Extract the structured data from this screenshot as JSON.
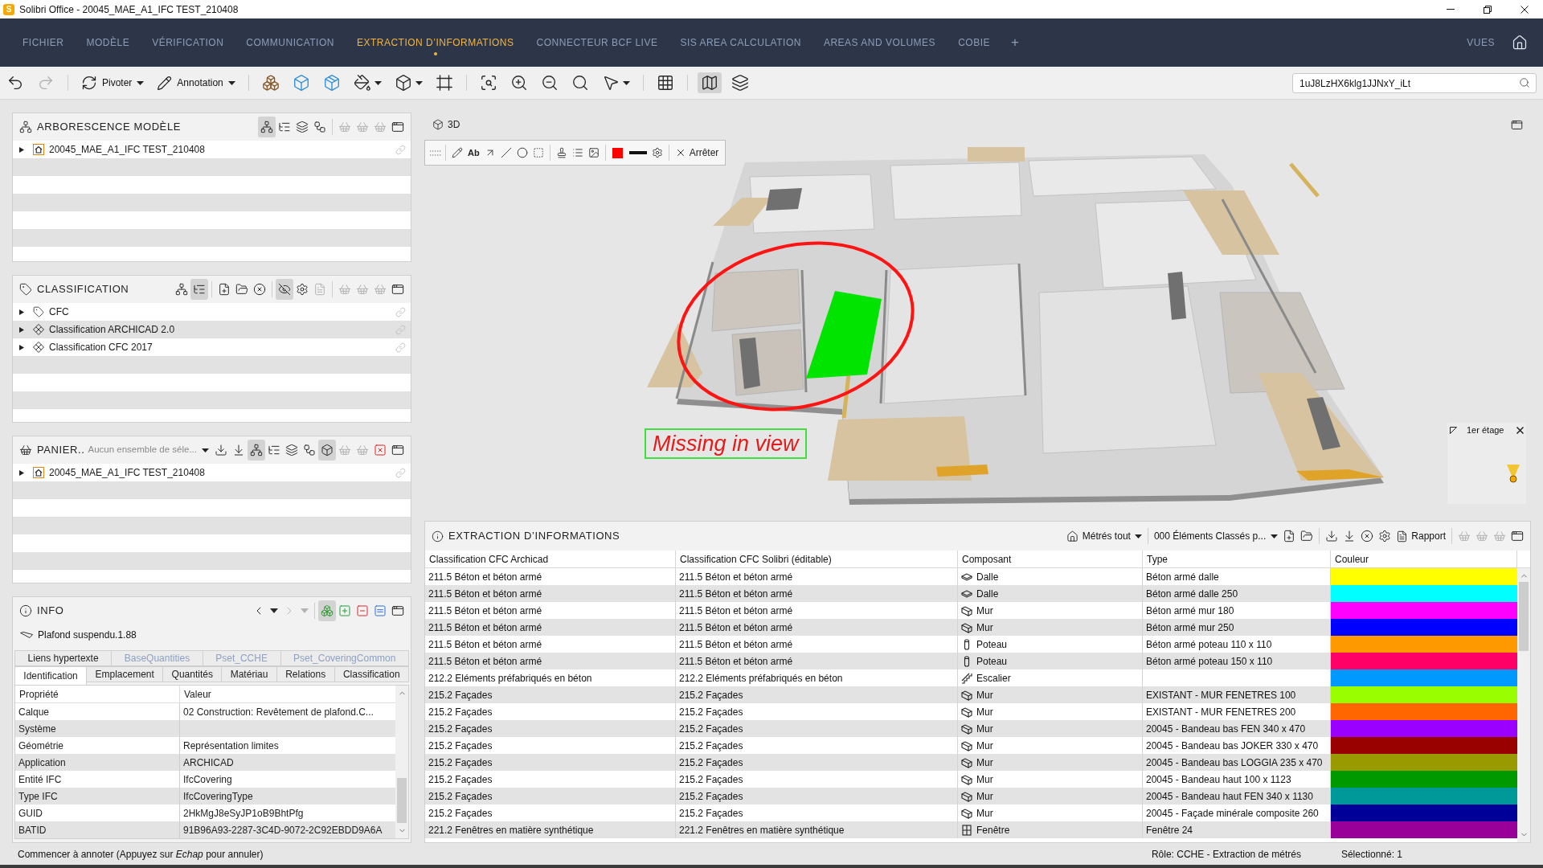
{
  "window": {
    "logo": "S",
    "title": "Solibri Office - 20045_MAE_A1_IFC TEST_210408"
  },
  "menu": {
    "items": [
      {
        "label": "FICHIER",
        "selected": false
      },
      {
        "label": "MODÈLE",
        "selected": false
      },
      {
        "label": "VÉRIFICATION",
        "selected": false
      },
      {
        "label": "COMMUNICATION",
        "selected": false
      },
      {
        "label": "EXTRACTION D’INFORMATIONS",
        "selected": true
      },
      {
        "label": "CONNECTEUR BCF LIVE",
        "selected": false
      },
      {
        "label": "SIS AREA CALCULATION",
        "selected": false
      },
      {
        "label": "AREAS AND VOLUMES",
        "selected": false
      },
      {
        "label": "COBIE",
        "selected": false
      }
    ],
    "add": "+",
    "views": "VUES"
  },
  "toolbar": {
    "rotate": "Pivoter",
    "annotation": "Annotation",
    "tools": [
      {
        "pressed": false,
        "disabled": false
      },
      {
        "pressed": false,
        "disabled": true
      },
      {
        "pressed": false,
        "disabled": false
      },
      {
        "pressed": false,
        "disabled": false
      },
      {
        "pressed": false,
        "disabled": false
      },
      {
        "pressed": false,
        "disabled": false
      },
      {
        "pressed": false,
        "disabled": false
      },
      {
        "pressed": false,
        "disabled": false
      },
      {
        "pressed": false,
        "disabled": false
      },
      {
        "pressed": false,
        "disabled": false
      },
      {
        "pressed": false,
        "disabled": false
      },
      {
        "pressed": false,
        "disabled": false
      },
      {
        "pressed": false,
        "disabled": false
      },
      {
        "pressed": false,
        "disabled": false
      },
      {
        "pressed": true,
        "disabled": false
      },
      {
        "pressed": false,
        "disabled": false
      }
    ],
    "search": {
      "value": "1uJ8LzHX6klg1JJNxY_iLt"
    }
  },
  "model_tree": {
    "title": "ARBORESCENCE MODÈLE",
    "tools": [
      {
        "pressed": true,
        "disabled": false
      },
      {
        "pressed": false,
        "disabled": false
      },
      {
        "pressed": false,
        "disabled": false
      },
      {
        "pressed": false,
        "disabled": false
      },
      {
        "pressed": false,
        "disabled": true
      },
      {
        "pressed": false,
        "disabled": true
      },
      {
        "pressed": false,
        "disabled": true
      },
      {
        "pressed": false,
        "disabled": false
      }
    ],
    "items": [
      {
        "kind": "model",
        "label": "20045_MAE_A1_IFC TEST_210408",
        "expanded": false
      }
    ]
  },
  "classification": {
    "title": "CLASSIFICATION",
    "tools": [
      {
        "pressed": false,
        "disabled": false
      },
      {
        "pressed": true,
        "disabled": false
      },
      {
        "pressed": false,
        "disabled": false
      },
      {
        "pressed": false,
        "disabled": false
      },
      {
        "pressed": false,
        "disabled": false
      },
      {
        "pressed": true,
        "disabled": false
      },
      {
        "pressed": false,
        "disabled": false
      },
      {
        "pressed": false,
        "disabled": true
      },
      {
        "pressed": false,
        "disabled": true
      },
      {
        "pressed": false,
        "disabled": true
      },
      {
        "pressed": false,
        "disabled": true
      },
      {
        "pressed": false,
        "disabled": false
      }
    ],
    "items": [
      {
        "kind": "tag",
        "label": "CFC",
        "expanded": false
      },
      {
        "kind": "scheme",
        "label": "Classification ARCHICAD 2.0",
        "expanded": false
      },
      {
        "kind": "scheme",
        "label": "Classification CFC 2017",
        "expanded": false
      }
    ]
  },
  "basket": {
    "title": "PANIER..",
    "selection_set": "Aucun ensemble de séle...",
    "tools": [
      {
        "pressed": false,
        "disabled": false
      },
      {
        "pressed": false,
        "disabled": false
      },
      {
        "pressed": true,
        "disabled": false
      },
      {
        "pressed": false,
        "disabled": false
      },
      {
        "pressed": false,
        "disabled": false
      },
      {
        "pressed": false,
        "disabled": false
      },
      {
        "pressed": true,
        "disabled": false
      },
      {
        "pressed": false,
        "disabled": true
      },
      {
        "pressed": false,
        "disabled": true
      },
      {
        "pressed": false,
        "disabled": false
      },
      {
        "pressed": false,
        "disabled": false
      }
    ],
    "items": [
      {
        "kind": "model",
        "label": "20045_MAE_A1_IFC TEST_210408",
        "expanded": false
      }
    ]
  },
  "info": {
    "title": "INFO",
    "tools": [
      {
        "pressed": false,
        "disabled": false
      },
      {
        "pressed": false,
        "disabled": false
      },
      {
        "pressed": false,
        "disabled": true
      },
      {
        "pressed": false,
        "disabled": true
      },
      {
        "pressed": true,
        "disabled": false
      },
      {
        "pressed": false,
        "disabled": false
      },
      {
        "pressed": false,
        "disabled": false
      },
      {
        "pressed": false,
        "disabled": false
      },
      {
        "pressed": false,
        "disabled": false
      }
    ],
    "element": "Plafond suspendu.1.88",
    "tab_rows": [
      [
        {
          "label": "Liens hypertexte",
          "selected": false,
          "disabled": false
        },
        {
          "label": "BaseQuantities",
          "selected": false,
          "disabled": true
        },
        {
          "label": "Pset_CCHE",
          "selected": false,
          "disabled": true
        },
        {
          "label": "Pset_CoveringCommon",
          "selected": false,
          "disabled": true
        }
      ],
      [
        {
          "label": "Identification",
          "selected": true,
          "disabled": false
        },
        {
          "label": "Emplacement",
          "selected": false,
          "disabled": false
        },
        {
          "label": "Quantités",
          "selected": false,
          "disabled": false
        },
        {
          "label": "Matériau",
          "selected": false,
          "disabled": false
        },
        {
          "label": "Relations",
          "selected": false,
          "disabled": false
        },
        {
          "label": "Classification",
          "selected": false,
          "disabled": false
        }
      ]
    ],
    "columns": [
      "Propriété",
      "Valeur"
    ],
    "rows": [
      {
        "property": "Calque",
        "value": "02 Construction: Revêtement de plafond.C..."
      },
      {
        "property": "Système"
      },
      {
        "property": "Géométrie",
        "value": "Représentation limites"
      },
      {
        "property": "Application",
        "value": "ARCHICAD"
      },
      {
        "property": "Entité IFC",
        "value": "IfcCovering"
      },
      {
        "property": "Type IFC",
        "value": "IfcCoveringType"
      },
      {
        "property": "GUID",
        "value": "2HkMgJ8eSyJP1oB9BhtPfg"
      },
      {
        "property": "BATID",
        "value": "91B96A93-2287-3C4D-9072-2C92EBDD9A6A"
      }
    ]
  },
  "viewport": {
    "title": "3D",
    "text_tool": "Ab",
    "stop": "Arrêter",
    "annotation_text": "Missing in view",
    "minimap": {
      "floor": "1er étage"
    }
  },
  "extraction": {
    "title": "EXTRACTION D’INFORMATIONS",
    "quantities": "Métrés tout",
    "filter": "000 Éléments Classés p...",
    "report": "Rapport",
    "tools": [
      {
        "disabled": false
      },
      {
        "disabled": false
      },
      {
        "disabled": false
      },
      {
        "disabled": false
      },
      {
        "disabled": false
      },
      {
        "disabled": false
      },
      {
        "disabled": true
      },
      {
        "disabled": true
      },
      {
        "disabled": true
      },
      {
        "disabled": false
      }
    ],
    "columns": [
      "Classification CFC Archicad",
      "Classification CFC Solibri (éditable)",
      "Composant",
      "Type",
      "Couleur"
    ],
    "rows": [
      {
        "archicad": "211.5 Béton et béton armé",
        "solibri": "211.5 Béton et béton armé",
        "component": {
          "kind": "slab",
          "label": "Dalle"
        },
        "type": "Béton armé dalle",
        "color": "#ffff00"
      },
      {
        "archicad": "211.5 Béton et béton armé",
        "solibri": "211.5 Béton et béton armé",
        "component": {
          "kind": "slab",
          "label": "Dalle"
        },
        "type": "Béton armé dalle 250",
        "color": "#00ffff"
      },
      {
        "archicad": "211.5 Béton et béton armé",
        "solibri": "211.5 Béton et béton armé",
        "component": {
          "kind": "wall",
          "label": "Mur"
        },
        "type": "Béton armé mur 180",
        "color": "#ff00ff"
      },
      {
        "archicad": "211.5 Béton et béton armé",
        "solibri": "211.5 Béton et béton armé",
        "component": {
          "kind": "wall",
          "label": "Mur"
        },
        "type": "Béton armé mur 250",
        "color": "#0000ff"
      },
      {
        "archicad": "211.5 Béton et béton armé",
        "solibri": "211.5 Béton et béton armé",
        "component": {
          "kind": "column",
          "label": "Poteau"
        },
        "type": "Béton armé poteau 110 x 110",
        "color": "#ff9900"
      },
      {
        "archicad": "211.5 Béton et béton armé",
        "solibri": "211.5 Béton et béton armé",
        "component": {
          "kind": "column",
          "label": "Poteau"
        },
        "type": "Béton armé poteau 150 x 110",
        "color": "#ff0066"
      },
      {
        "archicad": "212.2 Eléments préfabriqués en béton",
        "solibri": "212.2 Eléments préfabriqués en béton",
        "component": {
          "kind": "stair",
          "label": "Escalier"
        },
        "color": "#0099ff"
      },
      {
        "archicad": "215.2 Façades",
        "solibri": "215.2 Façades",
        "component": {
          "kind": "wall",
          "label": "Mur"
        },
        "type": "EXISTANT - MUR FENETRES 100",
        "color": "#99ff00"
      },
      {
        "archicad": "215.2 Façades",
        "solibri": "215.2 Façades",
        "component": {
          "kind": "wall",
          "label": "Mur"
        },
        "type": "EXISTANT - MUR FENETRES 200",
        "color": "#ff6600"
      },
      {
        "archicad": "215.2 Façades",
        "solibri": "215.2 Façades",
        "component": {
          "kind": "wall",
          "label": "Mur"
        },
        "type": "20045 - Bandeau bas FEN 340 x 470",
        "color": "#9900ff"
      },
      {
        "archicad": "215.2 Façades",
        "solibri": "215.2 Façades",
        "component": {
          "kind": "wall",
          "label": "Mur"
        },
        "type": "20045 - Bandeau bas JOKER 330 x 470",
        "color": "#990000"
      },
      {
        "archicad": "215.2 Façades",
        "solibri": "215.2 Façades",
        "component": {
          "kind": "wall",
          "label": "Mur"
        },
        "type": "20045 - Bandeau bas LOGGIA 235 x 470",
        "color": "#999900"
      },
      {
        "archicad": "215.2 Façades",
        "solibri": "215.2 Façades",
        "component": {
          "kind": "wall",
          "label": "Mur"
        },
        "type": "20045 - Bandeau haut 100 x 1123",
        "color": "#009900"
      },
      {
        "archicad": "215.2 Façades",
        "solibri": "215.2 Façades",
        "component": {
          "kind": "wall",
          "label": "Mur"
        },
        "type": "20045 - Bandeau haut FEN 340 x 1130",
        "color": "#009999"
      },
      {
        "archicad": "215.2 Façades",
        "solibri": "215.2 Façades",
        "component": {
          "kind": "wall",
          "label": "Mur"
        },
        "type": "20045 - Façade minérale composite 260",
        "color": "#000099"
      },
      {
        "archicad": "221.2 Fenêtres en matière synthétique",
        "solibri": "221.2 Fenêtres en matière synthétique",
        "component": {
          "kind": "window",
          "label": "Fenêtre"
        },
        "type": "Fenêtre 24",
        "color": "#990099"
      }
    ]
  },
  "status_bar": {
    "message": "Commencer à annoter (Appuyez sur *Echap* pour annuler)",
    "role": "Rôle: CCHE - Extraction de métrés",
    "selection": "Sélectionné: 1"
  }
}
